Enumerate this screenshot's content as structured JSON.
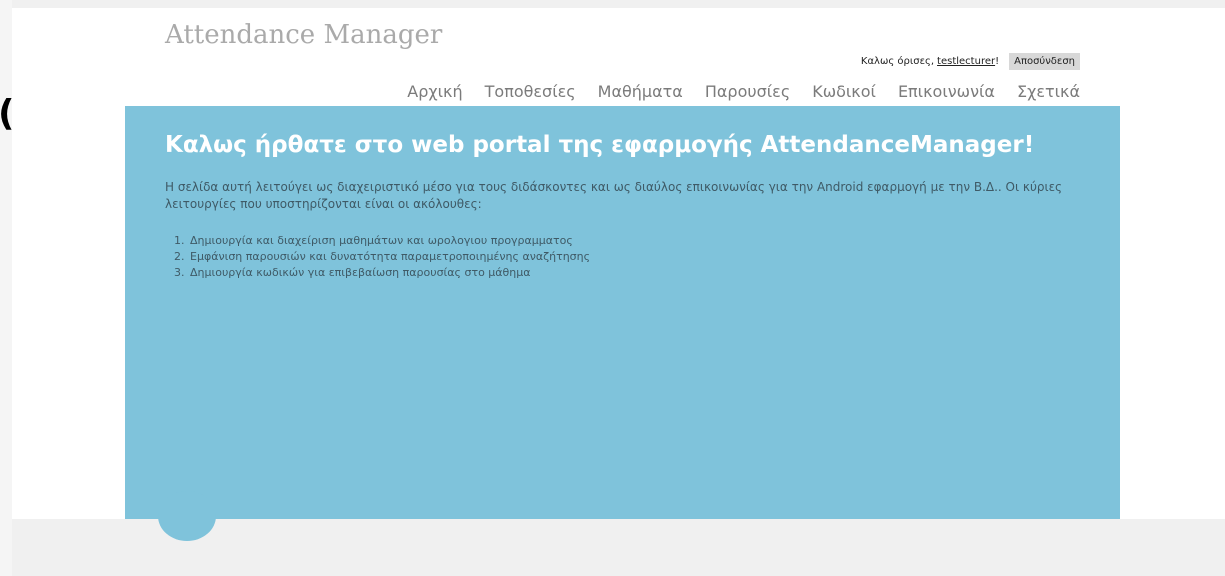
{
  "colors": {
    "content_bg": "#7fc3db",
    "brand_text": "#aaaaaa",
    "nav_text": "#7b7b7b",
    "heading": "#ffffff",
    "body_text": "#3f5a66",
    "footer_bg": "#f0f0f0",
    "logout_bg": "#d8d8d8"
  },
  "edge_glyph": "(",
  "header": {
    "brand": "Attendance Manager",
    "greeting": "Καλως όρισες,",
    "username": "testlecturer",
    "greeting_suffix": "!",
    "logout_label": "Αποσύνδεση"
  },
  "nav": {
    "items": [
      {
        "label": "Αρχική"
      },
      {
        "label": "Τοποθεσίες"
      },
      {
        "label": "Μαθήματα"
      },
      {
        "label": "Παρουσίες"
      },
      {
        "label": "Κωδικοί"
      },
      {
        "label": "Επικοινωνία"
      },
      {
        "label": "Σχετικά"
      }
    ]
  },
  "main": {
    "title": "Καλως ήρθατε στο web portal της εφαρμογής AttendanceManager!",
    "intro": "Η σελίδα αυτή λειτούγει ως διαχειριστικό μέσο για τους διδάσκοντες και ως διαύλος επικοινωνίας για την Android εφαρμογή με την Β.Δ.. Οι κύριες λειτουργίες που υποστηρίζονται είναι οι ακόλουθες:",
    "features": [
      "Δημιουργία και διαχείριση μαθημάτων και ωρολογιου προγραμματος",
      "Εμφάνιση παρουσιών και δυνατότητα παραμετροποιημένης αναζήτησης",
      "Δημιουργία κωδικών για επιβεβαίωση παρουσίας στο μάθημα"
    ]
  }
}
